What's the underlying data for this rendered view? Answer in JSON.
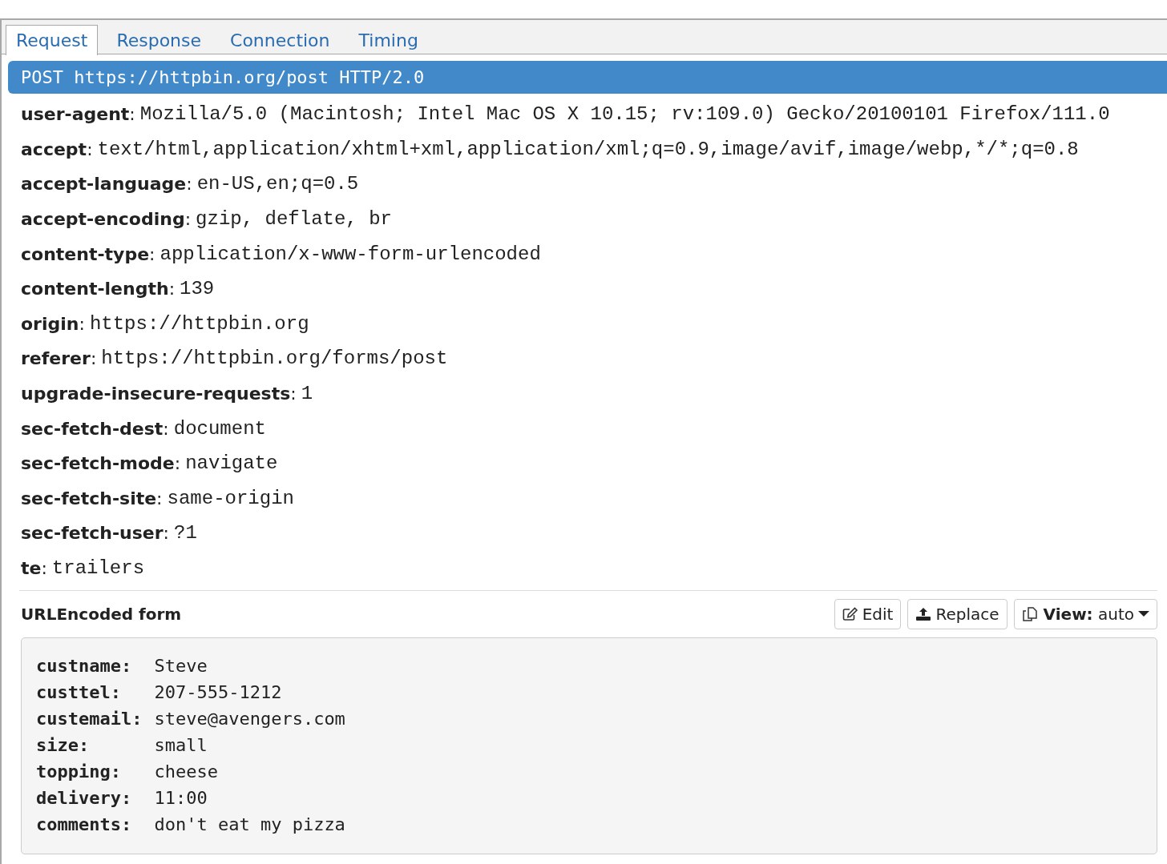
{
  "tabs": [
    {
      "label": "Request",
      "selected": true
    },
    {
      "label": "Response",
      "selected": false
    },
    {
      "label": "Connection",
      "selected": false
    },
    {
      "label": "Timing",
      "selected": false
    }
  ],
  "request_line": "POST https://httpbin.org/post HTTP/2.0",
  "headers": [
    {
      "name": "**user-agent**:",
      "value": "Mozilla/5.0 (Macintosh; Intel Mac OS X 10.15; rv:109.0) Gecko/20100101 Firefox/111.0"
    },
    {
      "name": "**accept**:",
      "value": "text/html,application/xhtml+xml,application/xml;q=0.9,image/avif,image/webp,*/*;q=0.8"
    },
    {
      "name": "**accept-language**:",
      "value": "en-US,en;q=0.5"
    },
    {
      "name": "**accept-encoding**:",
      "value": "gzip, deflate, br"
    },
    {
      "name": "**content-type**:",
      "value": "application/x-www-form-urlencoded"
    },
    {
      "name": "**content-length**:",
      "value": "139"
    },
    {
      "name": "**origin**:",
      "value": "https://httpbin.org"
    },
    {
      "name": "**referer**:",
      "value": "https://httpbin.org/forms/post"
    },
    {
      "name": "**upgrade-insecure-requests**:",
      "value": "1"
    },
    {
      "name": "**sec-fetch-dest**:",
      "value": "document"
    },
    {
      "name": "**sec-fetch-mode**:",
      "value": "navigate"
    },
    {
      "name": "**sec-fetch-site**:",
      "value": "same-origin"
    },
    {
      "name": "**sec-fetch-user**:",
      "value": "?1"
    },
    {
      "name": "**te**:",
      "value": "trailers"
    }
  ],
  "body": {
    "title": "URLEncoded form",
    "buttons": [
      {
        "kind": "edit",
        "label": "Edit"
      },
      {
        "kind": "replace",
        "label": "Replace"
      },
      {
        "kind": "view",
        "label": "**View:** auto"
      }
    ],
    "fields": [
      {
        "key": "custname:",
        "value": "Steve"
      },
      {
        "key": "custtel:",
        "value": "207-555-1212"
      },
      {
        "key": "custemail:",
        "value": "steve@avengers.com"
      },
      {
        "key": "size:",
        "value": "small"
      },
      {
        "key": "topping:",
        "value": "cheese"
      },
      {
        "key": "delivery:",
        "value": "11:00"
      },
      {
        "key": "comments:",
        "value": "don't eat my pizza"
      }
    ]
  }
}
